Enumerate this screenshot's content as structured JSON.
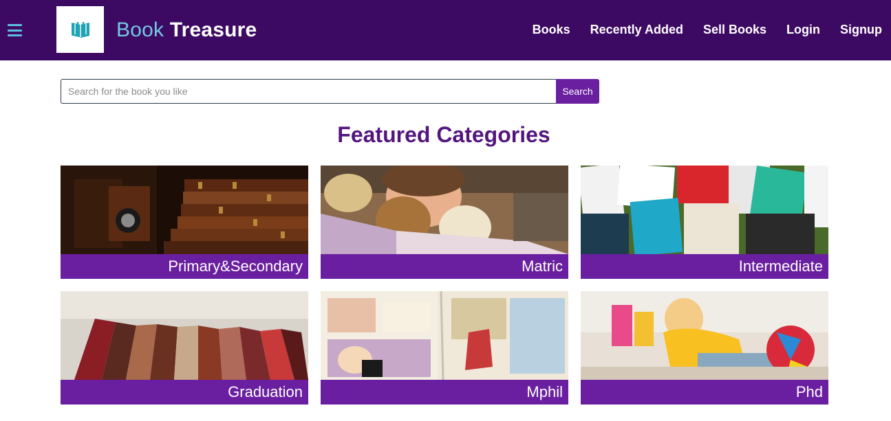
{
  "header": {
    "brand_first": "Book",
    "brand_second": "Treasure",
    "nav": [
      "Books",
      "Recently Added",
      "Sell Books",
      "Login",
      "Signup"
    ],
    "colors": {
      "bar": "#3d0a63",
      "accent": "#6a1fa0",
      "logo": "#1fa3b5"
    }
  },
  "icons": {
    "menu": "hamburger-icon",
    "logo": "open-book-icon"
  },
  "search": {
    "placeholder": "Search for the book you like",
    "button": "Search",
    "value": ""
  },
  "main": {
    "heading": "Featured Categories",
    "categories": [
      {
        "label": "Primary&Secondary",
        "image": "antique-camera-and-old-books"
      },
      {
        "label": "Matric",
        "image": "child-reading-with-teddy-bears"
      },
      {
        "label": "Intermediate",
        "image": "colorful-novels-on-grass"
      },
      {
        "label": "Graduation",
        "image": "row-of-old-leather-books"
      },
      {
        "label": "Mphil",
        "image": "open-comic-book"
      },
      {
        "label": "Phd",
        "image": "toddler-playing-with-ball"
      }
    ]
  }
}
